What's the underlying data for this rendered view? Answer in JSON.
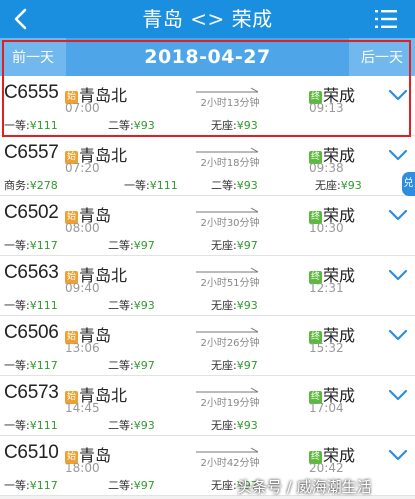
{
  "header": {
    "title": "青岛 <> 荣成"
  },
  "date_bar": {
    "prev_label": "前一天",
    "date": "2018-04-27",
    "next_label": "后一天"
  },
  "badges": {
    "start": "始",
    "end": "终"
  },
  "side_tab": "兑",
  "watermark": "头条号 / 威海潮生活",
  "trains": [
    {
      "number": "C6555",
      "from": "青岛北",
      "dep_time": "07:00",
      "duration": "2小时13分钟",
      "to": "荣成",
      "arr_time": "09:13",
      "prices": [
        {
          "label": "一等:",
          "amount": "¥111"
        },
        {
          "label": "二等:",
          "amount": "¥93"
        },
        {
          "label": "无座:",
          "amount": "¥93"
        }
      ]
    },
    {
      "number": "C6557",
      "from": "青岛北",
      "dep_time": "07:20",
      "duration": "2小时18分钟",
      "to": "荣成",
      "arr_time": "09:38",
      "prices": [
        {
          "label": "商务:",
          "amount": "¥278"
        },
        {
          "label": "一等:",
          "amount": "¥111"
        },
        {
          "label": "二等:",
          "amount": "¥93"
        },
        {
          "label": "无座:",
          "amount": "¥93"
        }
      ]
    },
    {
      "number": "C6502",
      "from": "青岛",
      "dep_time": "08:00",
      "duration": "2小时30分钟",
      "to": "荣成",
      "arr_time": "10:30",
      "prices": [
        {
          "label": "一等:",
          "amount": "¥117"
        },
        {
          "label": "二等:",
          "amount": "¥97"
        },
        {
          "label": "无座:",
          "amount": "¥97"
        }
      ]
    },
    {
      "number": "C6563",
      "from": "青岛北",
      "dep_time": "09:40",
      "duration": "2小时51分钟",
      "to": "荣成",
      "arr_time": "12:31",
      "prices": [
        {
          "label": "一等:",
          "amount": "¥111"
        },
        {
          "label": "二等:",
          "amount": "¥93"
        },
        {
          "label": "无座:",
          "amount": "¥93"
        }
      ]
    },
    {
      "number": "C6506",
      "from": "青岛",
      "dep_time": "13:06",
      "duration": "2小时26分钟",
      "to": "荣成",
      "arr_time": "15:32",
      "prices": [
        {
          "label": "一等:",
          "amount": "¥117"
        },
        {
          "label": "二等:",
          "amount": "¥97"
        },
        {
          "label": "无座:",
          "amount": "¥97"
        }
      ]
    },
    {
      "number": "C6573",
      "from": "青岛北",
      "dep_time": "14:45",
      "duration": "2小时19分钟",
      "to": "荣成",
      "arr_time": "17:04",
      "prices": [
        {
          "label": "一等:",
          "amount": "¥111"
        },
        {
          "label": "二等:",
          "amount": "¥93"
        },
        {
          "label": "无座:",
          "amount": "¥93"
        }
      ]
    },
    {
      "number": "C6510",
      "from": "青岛",
      "dep_time": "18:00",
      "duration": "2小时42分钟",
      "to": "荣成",
      "arr_time": "20:42",
      "prices": [
        {
          "label": "一等:",
          "amount": "¥117"
        },
        {
          "label": "二等:",
          "amount": "¥97"
        },
        {
          "label": "无座:",
          "amount": "¥97"
        }
      ]
    }
  ]
}
